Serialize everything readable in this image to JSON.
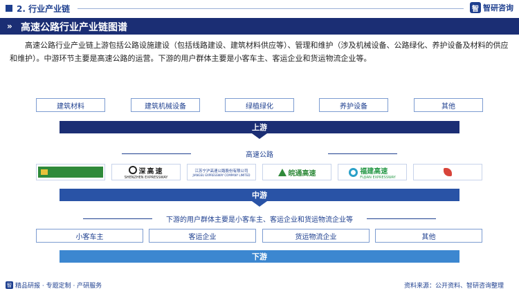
{
  "header": {
    "section": "2. 行业产业链",
    "brand": "智研咨询",
    "brand_icon": "智"
  },
  "title": "高速公路行业产业链图谱",
  "description": "高速公路行业产业链上游包括公路设施建设（包括线路建设、建筑材料供应等）、管理和维护（涉及机械设备、公路绿化、养护设备及材料的供应和维护）。中游环节主要是高速公路的运营。下游的用户群体主要是小客车主、客运企业和货运物流企业等。",
  "upstream": {
    "items": [
      "建筑材料",
      "建筑机械设备",
      "绿植绿化",
      "养护设备",
      "其他"
    ],
    "label": "上游",
    "color": "#1b2e74"
  },
  "midstream": {
    "sublabel": "高速公路",
    "companies": [
      {
        "name": ""
      },
      {
        "name": "深高速",
        "sub": "SHENZHEN EXPRESSWAY"
      },
      {
        "name": "江苏宁沪高速公路股份有限公司",
        "sub": "JIANGSU EXPRESSWAY COMPANY LIMITED"
      },
      {
        "name": "皖通高速",
        "sub": ""
      },
      {
        "name": "福建高速",
        "sub": "FUJIAN EXPRESSWAY"
      },
      {
        "name": "",
        "sub": ""
      }
    ],
    "label": "中游",
    "color": "#2953a6"
  },
  "downstream": {
    "sublabel": "下游的用户群体主要是小客车主、客运企业和货运物流企业等",
    "items": [
      "小客车主",
      "客运企业",
      "货运物流企业",
      "其他"
    ],
    "label": "下游",
    "color": "#3c87d0"
  },
  "footer": {
    "left": "精品研报 · 专题定制 · 产研服务",
    "left_icon": "智",
    "right": "资料来源：公开资料、智研咨询整理"
  }
}
